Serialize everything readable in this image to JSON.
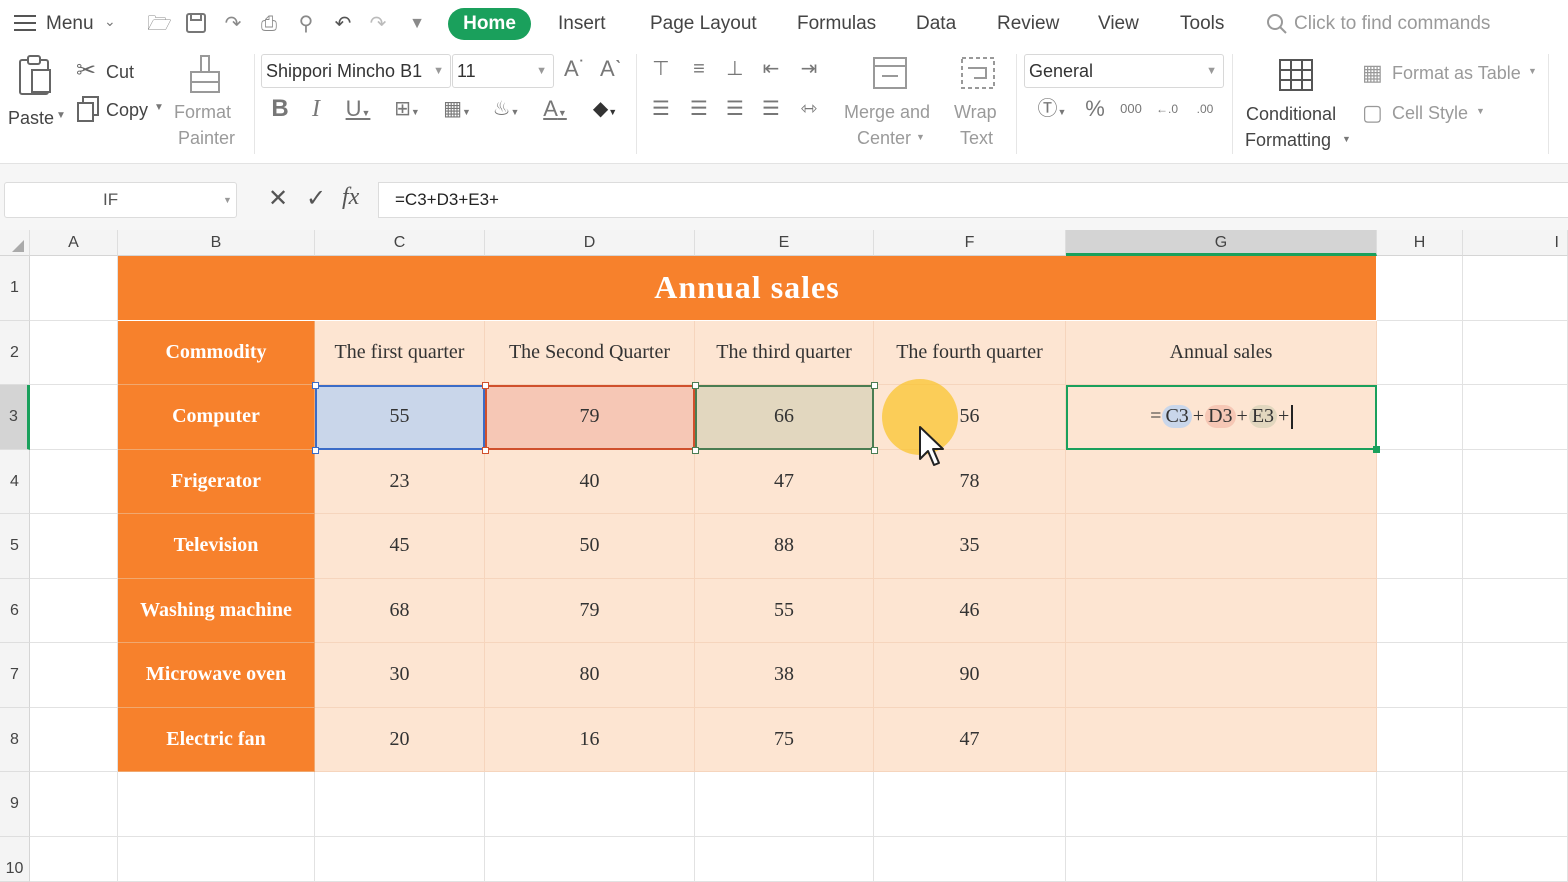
{
  "menubar": {
    "menu_label": "Menu",
    "tabs": [
      "Home",
      "Insert",
      "Page Layout",
      "Formulas",
      "Data",
      "Review",
      "View",
      "Tools"
    ],
    "search_placeholder": "Click to find commands"
  },
  "ribbon": {
    "clipboard": {
      "paste": "Paste",
      "cut": "Cut",
      "copy": "Copy",
      "format_painter_line1": "Format",
      "format_painter_line2": "Painter"
    },
    "font": {
      "family": "Shippori Mincho B1",
      "size": "11"
    },
    "alignment": {
      "merge_line1": "Merge and",
      "merge_line2": "Center",
      "wrap_line1": "Wrap",
      "wrap_line2": "Text"
    },
    "number": {
      "format": "General"
    },
    "styles": {
      "cond_line1": "Conditional",
      "cond_line2": "Formatting",
      "format_as_table": "Format as Table",
      "cell_style": "Cell Style"
    }
  },
  "formula_bar": {
    "name_box": "IF",
    "formula": "=C3+D3+E3+"
  },
  "sheet": {
    "columns": [
      "A",
      "B",
      "C",
      "D",
      "E",
      "F",
      "G",
      "H",
      "I"
    ],
    "rows": [
      "1",
      "2",
      "3",
      "4",
      "5",
      "6",
      "7",
      "8",
      "9",
      "10"
    ],
    "title": "Annual sales",
    "headers": [
      "Commodity",
      "The first quarter",
      "The Second Quarter",
      "The third quarter",
      "The fourth quarter",
      "Annual sales"
    ],
    "data": [
      {
        "name": "Computer",
        "values": [
          "55",
          "79",
          "66",
          "56"
        ]
      },
      {
        "name": "Frigerator",
        "values": [
          "23",
          "40",
          "47",
          "78"
        ]
      },
      {
        "name": "Television",
        "values": [
          "45",
          "50",
          "88",
          "35"
        ]
      },
      {
        "name": "Washing machine",
        "values": [
          "68",
          "79",
          "55",
          "46"
        ]
      },
      {
        "name": "Microwave oven",
        "values": [
          "30",
          "80",
          "38",
          "90"
        ]
      },
      {
        "name": "Electric fan",
        "values": [
          "20",
          "16",
          "75",
          "47"
        ]
      }
    ],
    "editing_cell": {
      "tokens": [
        "=",
        "C3",
        "+",
        "D3",
        "+",
        "E3",
        "+"
      ]
    }
  },
  "colors": {
    "accent_green": "#1aa05c",
    "category_orange": "#f7812c",
    "peach_fill": "#fde5d2",
    "ref_blue": "#c9d6ea",
    "ref_red": "#f6c7b5",
    "ref_olive": "#e2d7bf"
  }
}
